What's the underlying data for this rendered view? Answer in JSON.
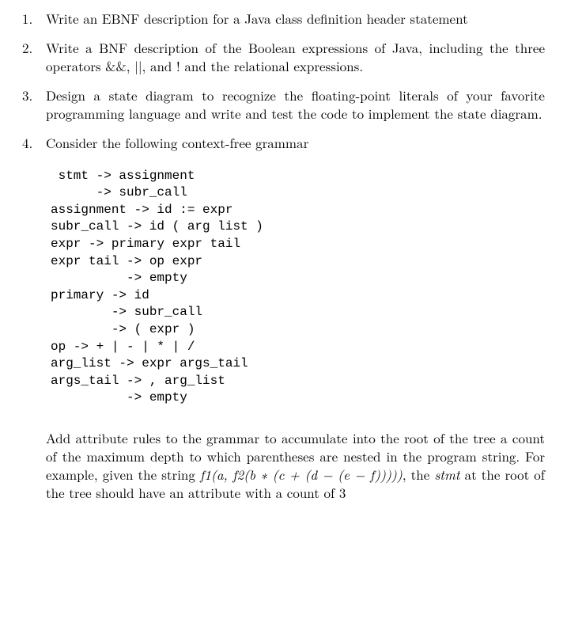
{
  "items": [
    {
      "text": "Write an EBNF description for a Java class definition header statement"
    },
    {
      "text": "Write a BNF description of the Boolean expressions of Java, including the three operators &&, ||, and ! and the relational expressions."
    },
    {
      "text": "Design a state diagram to recognize the floating-point literals of your favorite programming language and write and test the code to implement the state diagram."
    },
    {
      "text": "Consider the following context-free grammar"
    }
  ],
  "grammar": " stmt -> assignment\n      -> subr_call\nassignment -> id := expr\nsubr_call -> id ( arg list )\nexpr -> primary expr tail\nexpr tail -> op expr\n          -> empty\nprimary -> id\n        -> subr_call\n        -> ( expr )\nop -> + | - | * | /\narg_list -> expr args_tail\nargs_tail -> , arg_list\n          -> empty",
  "q4_post": {
    "lead": "Add attribute rules to the grammar to accumulate into the root of the tree a count of the maximum depth to which parentheses are nested in the program string. For example, given the string ",
    "expr": "f1(a, f2(b ∗ (c + (d − (e − f)))))",
    "mid": ", the ",
    "stmt_word": "stmt",
    "tail": " at the root of the tree should have an attribute with a count of 3"
  }
}
